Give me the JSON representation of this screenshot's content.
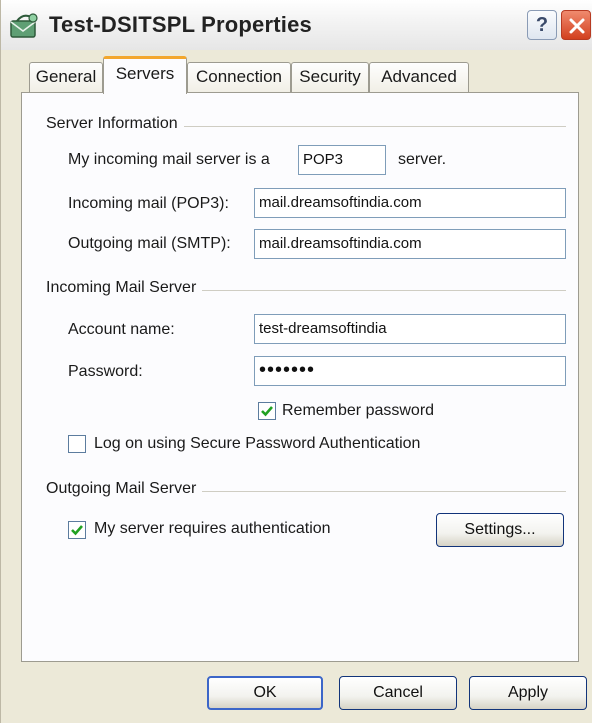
{
  "window": {
    "title": "Test-DSITSPL Properties",
    "help_label": "?",
    "icon": "mail-account-icon"
  },
  "tabs": [
    {
      "label": "General",
      "active": false
    },
    {
      "label": "Servers",
      "active": true
    },
    {
      "label": "Connection",
      "active": false
    },
    {
      "label": "Security",
      "active": false
    },
    {
      "label": "Advanced",
      "active": false
    }
  ],
  "server_info": {
    "group_label": "Server Information",
    "incoming_type_prefix": "My incoming mail server is a",
    "incoming_type_value": "POP3",
    "incoming_type_suffix": "server.",
    "incoming_label": "Incoming mail (POP3):",
    "incoming_value": "mail.dreamsoftindia.com",
    "outgoing_label": "Outgoing mail (SMTP):",
    "outgoing_value": "mail.dreamsoftindia.com"
  },
  "incoming_server": {
    "group_label": "Incoming Mail Server",
    "account_label": "Account name:",
    "account_value": "test-dreamsoftindia",
    "password_label": "Password:",
    "password_value": "•••••••",
    "remember_label": "Remember password",
    "remember_checked": true,
    "spa_label": "Log on using Secure Password Authentication",
    "spa_checked": false
  },
  "outgoing_server": {
    "group_label": "Outgoing Mail Server",
    "auth_label": "My server requires authentication",
    "auth_checked": true,
    "settings_label": "Settings..."
  },
  "buttons": {
    "ok": "OK",
    "cancel": "Cancel",
    "apply": "Apply"
  },
  "colors": {
    "tab_active_accent": "#f3a72c",
    "close_button": "#d2401f",
    "checkmark": "#21a121"
  }
}
